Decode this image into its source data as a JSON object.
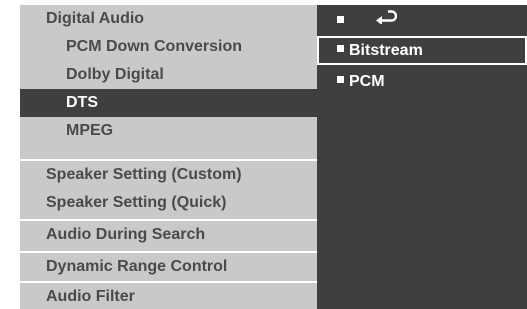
{
  "menu": {
    "items": [
      {
        "label": "Digital Audio"
      },
      {
        "label": "PCM Down Conversion"
      },
      {
        "label": "Dolby Digital"
      },
      {
        "label": "DTS"
      },
      {
        "label": "MPEG"
      },
      {
        "label": "Speaker Setting (Custom)"
      },
      {
        "label": "Speaker Setting (Quick)"
      },
      {
        "label": "Audio  During Search"
      },
      {
        "label": "Dynamic Range Control"
      },
      {
        "label": "Audio Filter"
      }
    ],
    "selected": "DTS"
  },
  "options": {
    "return_icon": "return-arrow-icon",
    "items": [
      {
        "label": "Bitstream"
      },
      {
        "label": "PCM"
      }
    ],
    "highlighted": "Bitstream"
  },
  "colors": {
    "menu_bg": "#c9c9c9",
    "menu_text": "#4a4a4a",
    "selected_bg": "#3f3f3f",
    "panel_bg": "#3f3f3f",
    "highlight_border": "#ffffff"
  }
}
